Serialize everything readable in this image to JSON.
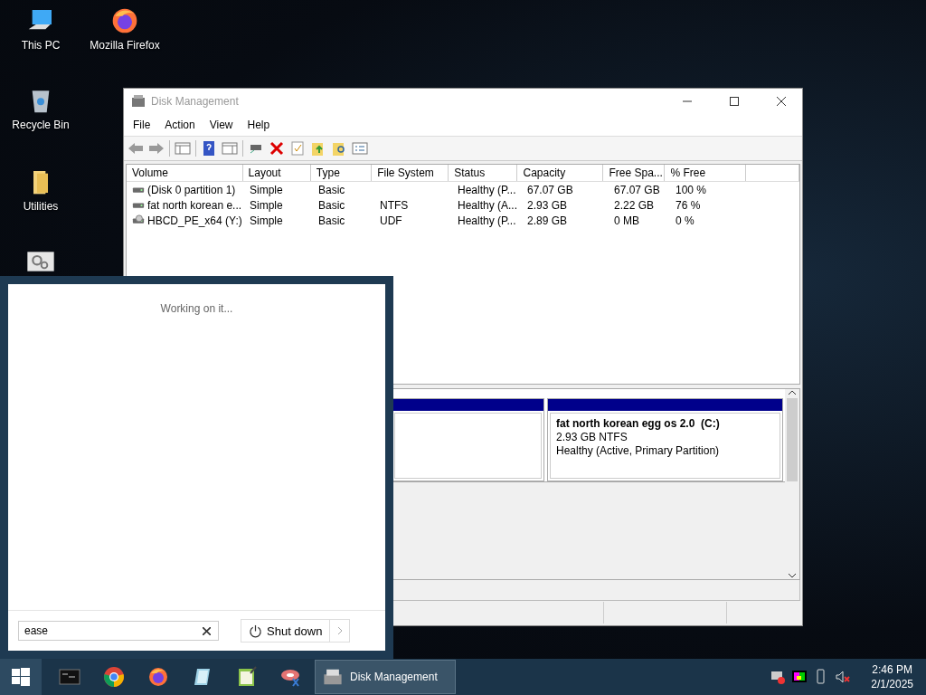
{
  "desktop_icons": [
    {
      "kind": "pc",
      "label": "This PC"
    },
    {
      "kind": "firefox",
      "label": "Mozilla Firefox"
    },
    {
      "kind": "bin",
      "label": "Recycle Bin"
    },
    {
      "kind": "folder",
      "label": "Utilities"
    },
    {
      "kind": "settings"
    }
  ],
  "window": {
    "title": "Disk Management",
    "menu": [
      "File",
      "Action",
      "View",
      "Help"
    ],
    "table": {
      "columns": [
        "Volume",
        "Layout",
        "Type",
        "File System",
        "Status",
        "Capacity",
        "Free Spa...",
        "% Free"
      ],
      "rows": [
        {
          "kind": "drive",
          "volume": "(Disk 0 partition 1)",
          "layout": "Simple",
          "type": "Basic",
          "status": "Healthy (P...",
          "capacity": "67.07 GB",
          "free_space": "67.07 GB",
          "percent_free": "100 %"
        },
        {
          "kind": "drive",
          "volume": "fat north korean e...",
          "layout": "Simple",
          "type": "Basic",
          "file_system": "NTFS",
          "status": "Healthy (A...",
          "capacity": "2.93 GB",
          "free_space": "2.22 GB",
          "percent_free": "76 %"
        },
        {
          "kind": "cd",
          "volume": "HBCD_PE_x64 (Y:)",
          "layout": "Simple",
          "type": "Basic",
          "file_system": "UDF",
          "status": "Healthy (P...",
          "capacity": "2.89 GB",
          "free_space": "0 MB",
          "percent_free": "0 %"
        }
      ]
    },
    "partition": {
      "label": "fat north korean egg os 2.0  (C:)",
      "size": "2.93 GB NTFS",
      "status": "Healthy (Active, Primary Partition)"
    }
  },
  "start_menu": {
    "status": "Working on it...",
    "search": {
      "value": "ease"
    },
    "power": "Shut down"
  },
  "taskbar": {
    "apps": [
      {
        "kind": "terminal"
      },
      {
        "kind": "chrome"
      },
      {
        "kind": "firefox"
      },
      {
        "kind": "notepad"
      },
      {
        "kind": "editor"
      },
      {
        "kind": "tool"
      }
    ],
    "task": "Disk Management",
    "clock": {
      "time": "2:46 PM",
      "date": "2/1/2025"
    }
  }
}
